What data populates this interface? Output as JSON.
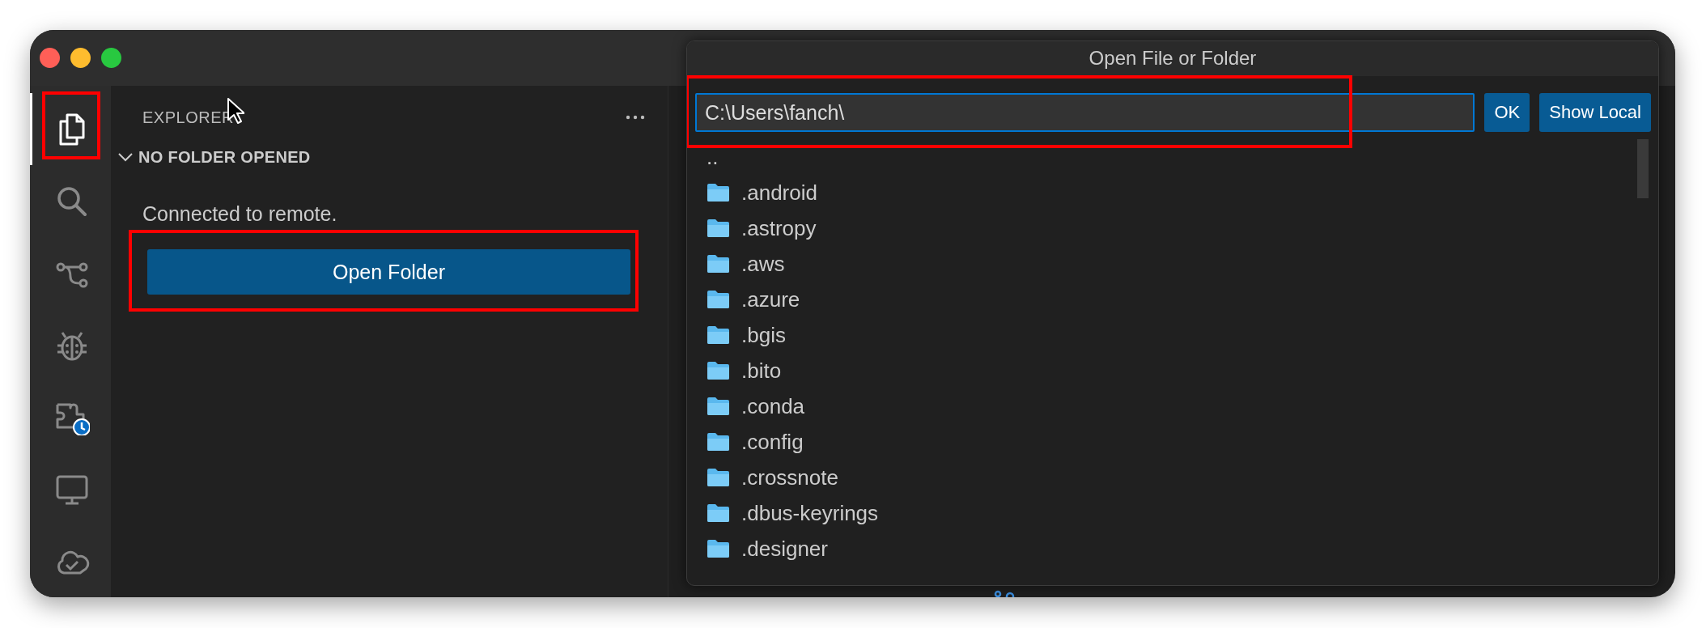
{
  "activity_bar": {
    "items": [
      {
        "kind": "explorer",
        "selected": true,
        "highlighted": true
      },
      {
        "kind": "search",
        "selected": false,
        "highlighted": false
      },
      {
        "kind": "source-control",
        "selected": false,
        "highlighted": false
      },
      {
        "kind": "debug",
        "selected": false,
        "highlighted": false
      },
      {
        "kind": "remote-explorer",
        "selected": false,
        "highlighted": false
      },
      {
        "kind": "monitor",
        "selected": false,
        "highlighted": false
      },
      {
        "kind": "cloud",
        "selected": false,
        "highlighted": false
      }
    ]
  },
  "sidebar": {
    "title": "EXPLORER",
    "section": {
      "title": "NO FOLDER OPENED",
      "expanded": true
    },
    "message": "Connected to remote.",
    "button": {
      "label": "Open Folder",
      "highlighted": true
    }
  },
  "dialog": {
    "title": "Open File or Folder",
    "path": {
      "value": "C:\\Users\\fanch\\",
      "highlighted": true
    },
    "buttons": [
      {
        "label": "OK"
      },
      {
        "label": "Show Local"
      }
    ],
    "items": [
      {
        "name": "..",
        "kind": "parent"
      },
      {
        "name": ".android",
        "kind": "folder"
      },
      {
        "name": ".astropy",
        "kind": "folder"
      },
      {
        "name": ".aws",
        "kind": "folder"
      },
      {
        "name": ".azure",
        "kind": "folder"
      },
      {
        "name": ".bgis",
        "kind": "folder"
      },
      {
        "name": ".bito",
        "kind": "folder"
      },
      {
        "name": ".conda",
        "kind": "folder"
      },
      {
        "name": ".config",
        "kind": "folder"
      },
      {
        "name": ".crossnote",
        "kind": "folder"
      },
      {
        "name": ".dbus-keyrings",
        "kind": "folder"
      },
      {
        "name": ".designer",
        "kind": "folder"
      }
    ]
  }
}
